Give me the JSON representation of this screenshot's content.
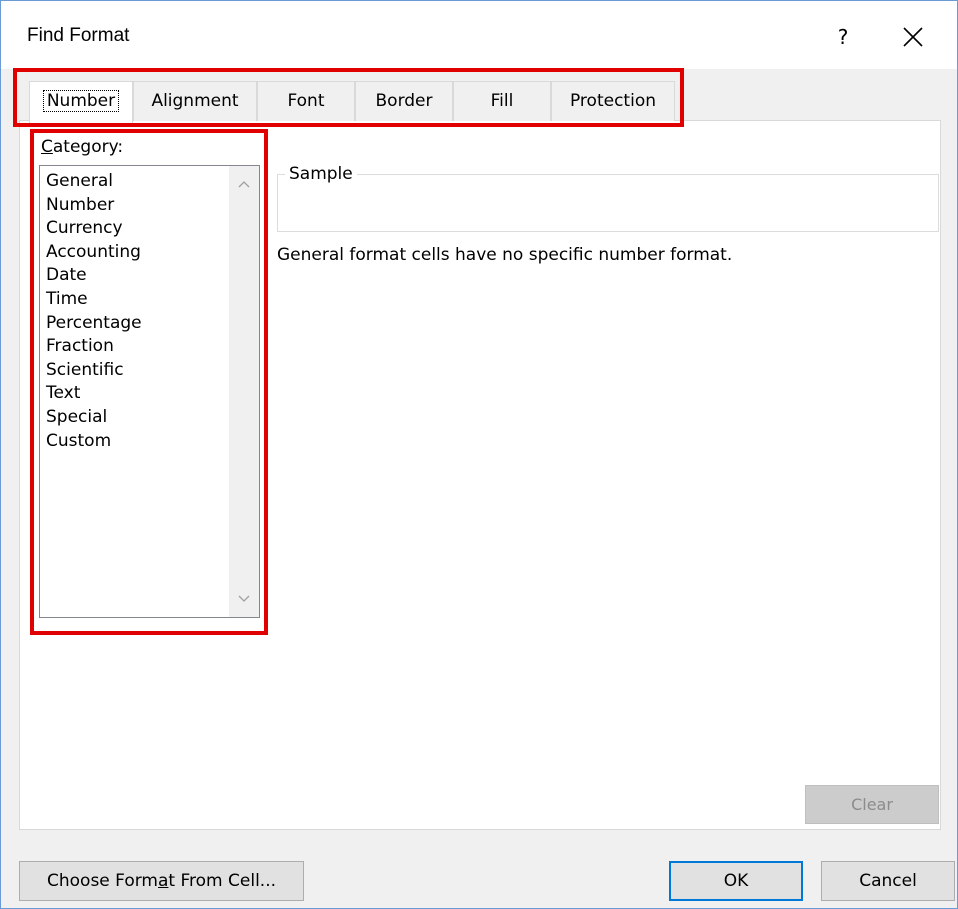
{
  "dialog": {
    "title": "Find Format",
    "help_label": "?"
  },
  "tabs": [
    {
      "label": "Number",
      "active": true
    },
    {
      "label": "Alignment",
      "active": false
    },
    {
      "label": "Font",
      "active": false
    },
    {
      "label": "Border",
      "active": false
    },
    {
      "label": "Fill",
      "active": false
    },
    {
      "label": "Protection",
      "active": false
    }
  ],
  "category": {
    "label_mnemonic": "C",
    "label_rest": "ategory:",
    "items": [
      "General",
      "Number",
      "Currency",
      "Accounting",
      "Date",
      "Time",
      "Percentage",
      "Fraction",
      "Scientific",
      "Text",
      "Special",
      "Custom"
    ],
    "selected": null
  },
  "sample": {
    "legend": "Sample",
    "value": ""
  },
  "description": "General format cells have no specific number format.",
  "buttons": {
    "clear": "Clear",
    "choose_pre": "Choose Form",
    "choose_mnemonic": "a",
    "choose_post": "t From Cell...",
    "ok": "OK",
    "cancel": "Cancel"
  },
  "colors": {
    "highlight": "#e00000",
    "focus_border": "#0078d7"
  }
}
